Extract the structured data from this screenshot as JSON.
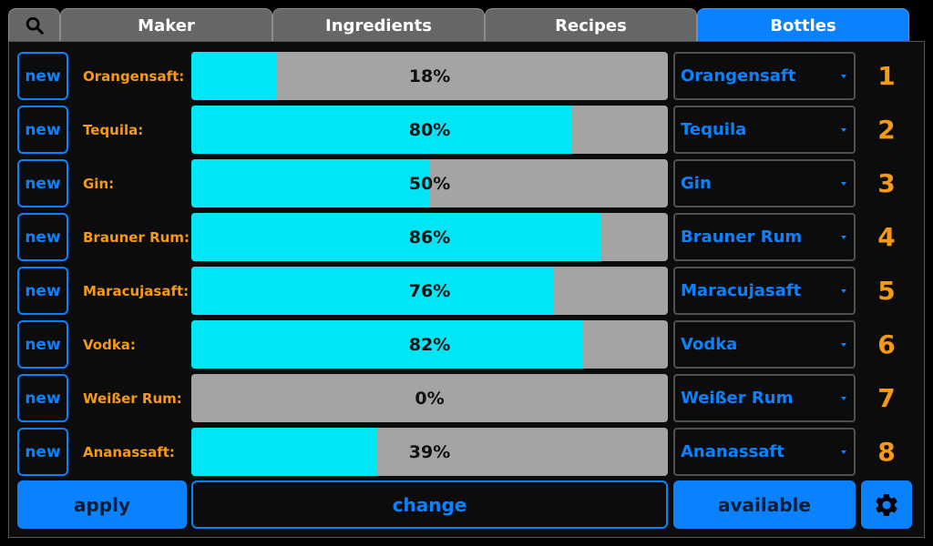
{
  "tabs": [
    {
      "label": "Maker"
    },
    {
      "label": "Ingredients"
    },
    {
      "label": "Recipes"
    },
    {
      "label": "Bottles",
      "active": true
    }
  ],
  "icons": {
    "search": "search-icon",
    "settings": "gear-icon"
  },
  "colors": {
    "accent": "#0a82ff",
    "label": "#f59a12",
    "fill": "#00e6f5",
    "empty": "#a4a4a4",
    "background": "#0c0c0c"
  },
  "bottles": [
    {
      "new_label": "new",
      "label": "Orangensaft:",
      "percent": 18,
      "percent_text": "18%",
      "selected": "Orangensaft",
      "number": "1"
    },
    {
      "new_label": "new",
      "label": "Tequila:",
      "percent": 80,
      "percent_text": "80%",
      "selected": "Tequila",
      "number": "2"
    },
    {
      "new_label": "new",
      "label": "Gin:",
      "percent": 50,
      "percent_text": "50%",
      "selected": "Gin",
      "number": "3"
    },
    {
      "new_label": "new",
      "label": "Brauner Rum:",
      "percent": 86,
      "percent_text": "86%",
      "selected": "Brauner Rum",
      "number": "4"
    },
    {
      "new_label": "new",
      "label": "Maracujasaft:",
      "percent": 76,
      "percent_text": "76%",
      "selected": "Maracujasaft",
      "number": "5"
    },
    {
      "new_label": "new",
      "label": "Vodka:",
      "percent": 82,
      "percent_text": "82%",
      "selected": "Vodka",
      "number": "6"
    },
    {
      "new_label": "new",
      "label": "Weißer Rum:",
      "percent": 0,
      "percent_text": "0%",
      "selected": "Weißer Rum",
      "number": "7"
    },
    {
      "new_label": "new",
      "label": "Ananassaft:",
      "percent": 39,
      "percent_text": "39%",
      "selected": "Ananassaft",
      "number": "8"
    }
  ],
  "actions": {
    "apply": "apply",
    "change": "change",
    "available": "available"
  }
}
